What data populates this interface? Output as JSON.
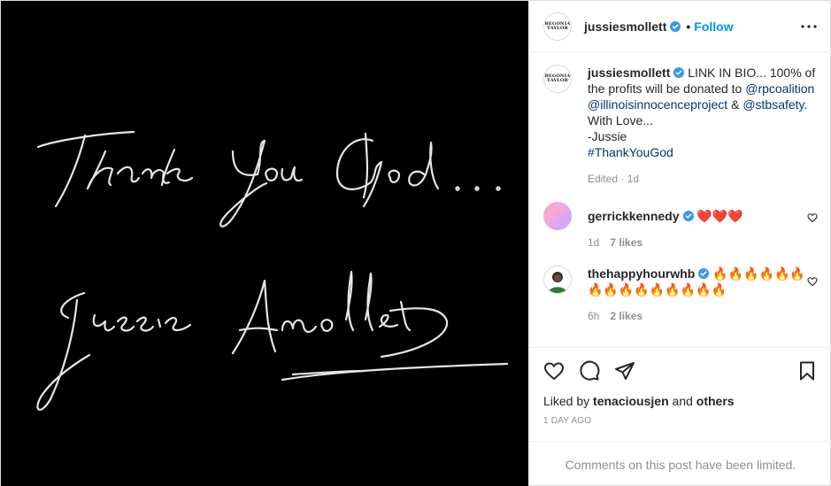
{
  "post": {
    "image_alt_lines": [
      "Thank You God...",
      "Jussie Smollett"
    ],
    "username": "jussiesmollett",
    "avatar_text": [
      "BEGONIA",
      "TAYLOR"
    ],
    "follow_label": "Follow",
    "separator": "•"
  },
  "caption": {
    "username": "jussiesmollett",
    "text_1": " LINK IN BIO... 100% of the profits will be donated to ",
    "mention_1": "@rpcoalition",
    "mention_2": "@illinoisinnocenceproject",
    "amp": " & ",
    "mention_3": "@stbsafety",
    "text_2": ". With Love...",
    "sign": "-Jussie",
    "hashtag": "#ThankYouGod",
    "meta": "Edited · 1d"
  },
  "comments": [
    {
      "username": "gerrickkennedy",
      "text": "❤️❤️❤️",
      "age": "1d",
      "likes": "7 likes"
    },
    {
      "username": "thehappyhourwhb",
      "text": "🔥🔥🔥🔥🔥🔥🔥🔥🔥🔥🔥🔥🔥🔥🔥",
      "age": "6h",
      "likes": "2 likes"
    }
  ],
  "liked_by": {
    "prefix": "Liked by ",
    "user": "tenaciousjen",
    "and": " and ",
    "others": "others"
  },
  "timestamp": "1 DAY AGO",
  "limited_notice": "Comments on this post have been limited.",
  "colors": {
    "link": "#0095f6",
    "verified": "#3897f0",
    "mention": "#00376b",
    "muted": "#8e8e8e"
  },
  "icons": [
    "verified-badge-icon",
    "more-options-icon",
    "heart-icon",
    "comment-icon",
    "share-icon",
    "bookmark-icon"
  ]
}
